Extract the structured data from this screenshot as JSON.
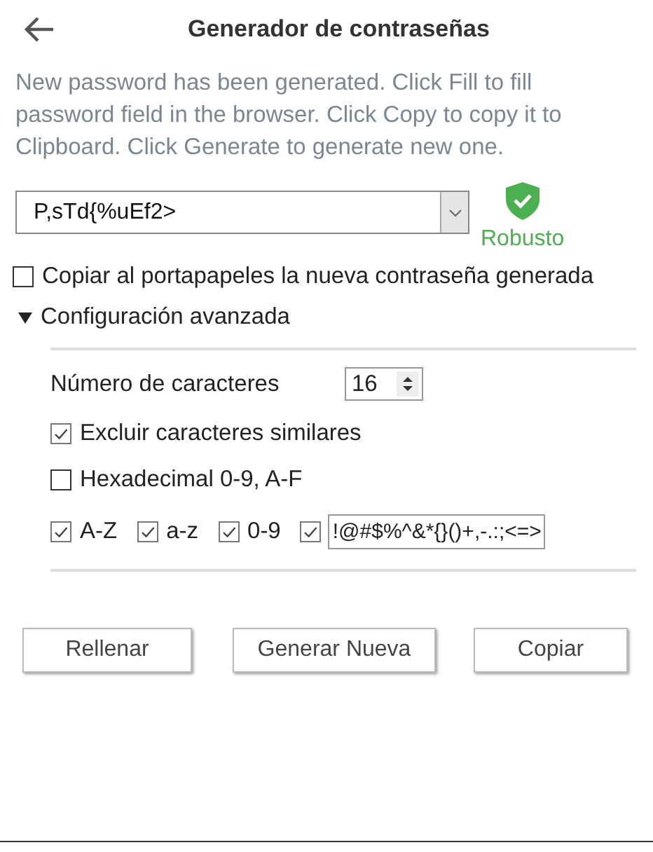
{
  "header": {
    "title": "Generador de contraseñas"
  },
  "description": "New password has been generated. Click Fill to fill password field in the browser. Click Copy to copy it to Clipboard. Click Generate to generate new one.",
  "password": {
    "value": "P,sTd{%uEf2>"
  },
  "strength": {
    "kind": "strong",
    "label": "Robusto"
  },
  "copy_to_clipboard": {
    "label": "Copiar al portapapeles la nueva contraseña generada",
    "checked": false
  },
  "advanced": {
    "label": "Configuración avanzada",
    "expanded": true,
    "length": {
      "label": "Número de caracteres",
      "value": "16"
    },
    "options": [
      {
        "label": "Excluir caracteres similares",
        "checked": true
      },
      {
        "label": "Hexadecimal 0-9, A-F",
        "checked": false
      }
    ],
    "charsets": [
      {
        "kind": "label",
        "label": "A-Z",
        "checked": true
      },
      {
        "kind": "label",
        "label": "a-z",
        "checked": true
      },
      {
        "kind": "label",
        "label": "0-9",
        "checked": true
      },
      {
        "kind": "field",
        "value": "!@#$%^&*{}()+,-.:;<=>",
        "checked": true
      }
    ]
  },
  "buttons": [
    "Rellenar",
    "Generar Nueva",
    "Copiar"
  ]
}
